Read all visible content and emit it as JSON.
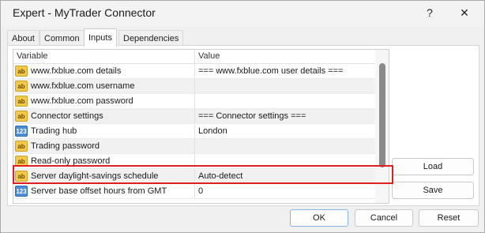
{
  "window": {
    "title": "Expert - MyTrader Connector",
    "help_glyph": "?",
    "close_glyph": "✕"
  },
  "tabs": [
    {
      "label": "About"
    },
    {
      "label": "Common"
    },
    {
      "label": "Inputs",
      "active": true
    },
    {
      "label": "Dependencies"
    }
  ],
  "grid": {
    "headers": {
      "variable": "Variable",
      "value": "Value"
    },
    "rows": [
      {
        "icon": "ab",
        "variable": "www.fxblue.com details",
        "value": "=== www.fxblue.com user details ==="
      },
      {
        "icon": "ab",
        "variable": "www.fxblue.com username",
        "value": ""
      },
      {
        "icon": "ab",
        "variable": "www.fxblue.com password",
        "value": ""
      },
      {
        "icon": "ab",
        "variable": "Connector settings",
        "value": "=== Connector settings ==="
      },
      {
        "icon": "123",
        "variable": "Trading hub",
        "value": "London",
        "highlighted": true
      },
      {
        "icon": "ab",
        "variable": "Trading password",
        "value": ""
      },
      {
        "icon": "ab",
        "variable": "Read-only password",
        "value": ""
      },
      {
        "icon": "ab",
        "variable": "Server daylight-savings schedule",
        "value": "Auto-detect"
      },
      {
        "icon": "123",
        "variable": "Server base offset hours from GMT",
        "value": "0"
      }
    ]
  },
  "side_buttons": {
    "load": "Load",
    "save": "Save"
  },
  "footer_buttons": {
    "ok": "OK",
    "cancel": "Cancel",
    "reset": "Reset"
  },
  "colors": {
    "highlight_border": "#e02020",
    "primary_border": "#8cb4e0"
  }
}
